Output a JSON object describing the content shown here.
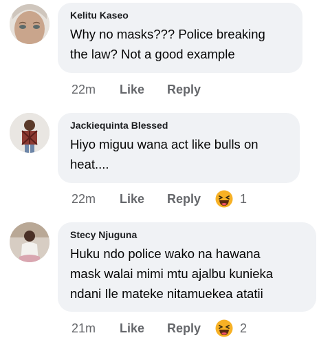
{
  "comments": [
    {
      "author": "Kelitu Kaseo",
      "text_lines": [
        "Why no masks??? Police breaking",
        "the law? Not a good example"
      ],
      "time": "22m",
      "like_label": "Like",
      "reply_label": "Reply",
      "reaction": null
    },
    {
      "author": "Jackiequinta Blessed",
      "text_lines": [
        "Hiyo miguu wana act like bulls on",
        "heat...."
      ],
      "time": "22m",
      "like_label": "Like",
      "reply_label": "Reply",
      "reaction": {
        "icon": "haha-reaction-icon",
        "count": "1"
      }
    },
    {
      "author": "Stecy Njuguna",
      "text_lines": [
        "Huku ndo police wako na hawana",
        "mask walai mimi mtu ajalbu kunieka",
        "ndani Ile mateke nitamuekea atatii"
      ],
      "time": "21m",
      "like_label": "Like",
      "reply_label": "Reply",
      "reaction": {
        "icon": "haha-reaction-icon",
        "count": "2"
      }
    }
  ],
  "colors": {
    "bubble": "#f0f2f5",
    "meta_text": "#65676b",
    "reaction_yellow": "#f7b125"
  }
}
